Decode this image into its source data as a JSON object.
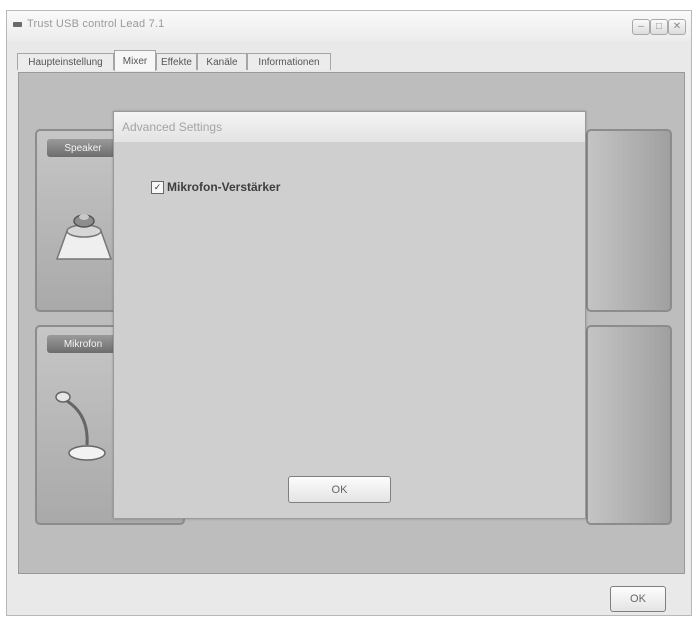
{
  "window": {
    "title": "Trust USB control Lead 7.1",
    "min_glyph": "–",
    "max_glyph": "□",
    "close_glyph": "✕"
  },
  "tabs": [
    {
      "label": "Haupteinstellung",
      "active": false
    },
    {
      "label": "Mixer",
      "active": true
    },
    {
      "label": "Effekte",
      "active": false
    },
    {
      "label": "Kanäle",
      "active": false
    },
    {
      "label": "Informationen",
      "active": false
    }
  ],
  "panels": {
    "top_label": "Speaker",
    "bottom_label": "Mikrofon"
  },
  "dialog": {
    "title": "Advanced Settings",
    "checkbox_label": "Mikrofon-Verstärker",
    "checkbox_checked": true,
    "checkbox_mark": "✓",
    "ok_label": "OK"
  },
  "footer": {
    "ok_label": "OK"
  },
  "icons": [
    "window-app-icon",
    "speaker-icon",
    "microphone-icon",
    "checkmark-icon"
  ]
}
